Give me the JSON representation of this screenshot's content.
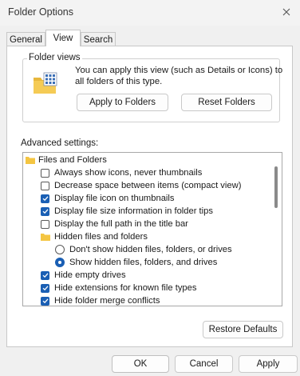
{
  "window": {
    "title": "Folder Options"
  },
  "tabs": [
    {
      "label": "General",
      "active": false
    },
    {
      "label": "View",
      "active": true
    },
    {
      "label": "Search",
      "active": false
    }
  ],
  "folder_views": {
    "legend": "Folder views",
    "description_line1": "You can apply this view (such as Details or Icons) to",
    "description_line2": "all folders of this type.",
    "apply_label": "Apply to Folders",
    "reset_label": "Reset Folders"
  },
  "advanced": {
    "label": "Advanced settings:",
    "items": [
      {
        "type": "folder",
        "label": "Files and Folders",
        "indent": 0
      },
      {
        "type": "checkbox",
        "label": "Always show icons, never thumbnails",
        "checked": false,
        "indent": 1
      },
      {
        "type": "checkbox",
        "label": "Decrease space between items (compact view)",
        "checked": false,
        "indent": 1
      },
      {
        "type": "checkbox",
        "label": "Display file icon on thumbnails",
        "checked": true,
        "indent": 1
      },
      {
        "type": "checkbox",
        "label": "Display file size information in folder tips",
        "checked": true,
        "indent": 1
      },
      {
        "type": "checkbox",
        "label": "Display the full path in the title bar",
        "checked": false,
        "indent": 1
      },
      {
        "type": "folder",
        "label": "Hidden files and folders",
        "indent": 1
      },
      {
        "type": "radio",
        "label": "Don't show hidden files, folders, or drives",
        "checked": false,
        "indent": 2
      },
      {
        "type": "radio",
        "label": "Show hidden files, folders, and drives",
        "checked": true,
        "indent": 2
      },
      {
        "type": "checkbox",
        "label": "Hide empty drives",
        "checked": true,
        "indent": 1
      },
      {
        "type": "checkbox",
        "label": "Hide extensions for known file types",
        "checked": true,
        "indent": 1
      },
      {
        "type": "checkbox",
        "label": "Hide folder merge conflicts",
        "checked": true,
        "indent": 1
      }
    ],
    "restore_label": "Restore Defaults"
  },
  "footer": {
    "ok_label": "OK",
    "cancel_label": "Cancel",
    "apply_label": "Apply"
  },
  "colors": {
    "accent": "#1a5fb4",
    "folder": "#f4c542"
  }
}
